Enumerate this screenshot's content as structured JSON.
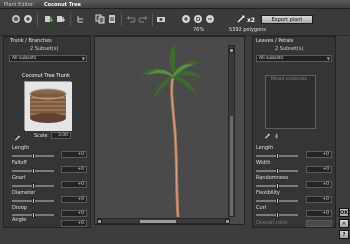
{
  "window": {
    "title_prefix": "Plant Editor:",
    "title_name": "Coconut Tree"
  },
  "toolbar": {
    "zoom": "76%",
    "polygons": "5392 polygons",
    "scale_label": "x2",
    "export_label": "Export plant"
  },
  "left_panel": {
    "title": "Trunk / Branches",
    "subsets_count": "2 Subset(s)",
    "subset_select": "All subsets",
    "texture_title": "Coconut Tree Trunk",
    "scale_label": "Scale",
    "scale_value": "3.00",
    "params": [
      {
        "label": "Length",
        "value": "+0"
      },
      {
        "label": "Falloff",
        "value": "+0"
      },
      {
        "label": "Gnarl",
        "value": "+0"
      },
      {
        "label": "Diameter",
        "value": "+0"
      },
      {
        "label": "Droop",
        "value": "+0"
      },
      {
        "label": "Angle",
        "value": "+0"
      }
    ]
  },
  "right_panel": {
    "title": "Leaves / Petals",
    "subsets_count": "2 Subset(s)",
    "subset_select": "All subsets",
    "preview_label": "Mixed materials",
    "params": [
      {
        "label": "Length",
        "value": "+0"
      },
      {
        "label": "Width",
        "value": "+0"
      },
      {
        "label": "Randomness",
        "value": "+0"
      },
      {
        "label": "Flexibility",
        "value": "+0"
      },
      {
        "label": "Curl",
        "value": "+0"
      }
    ],
    "overall_color_label": "Overall color"
  },
  "side_buttons": {
    "ok": "OK",
    "cancel": "✕",
    "help": "?"
  }
}
